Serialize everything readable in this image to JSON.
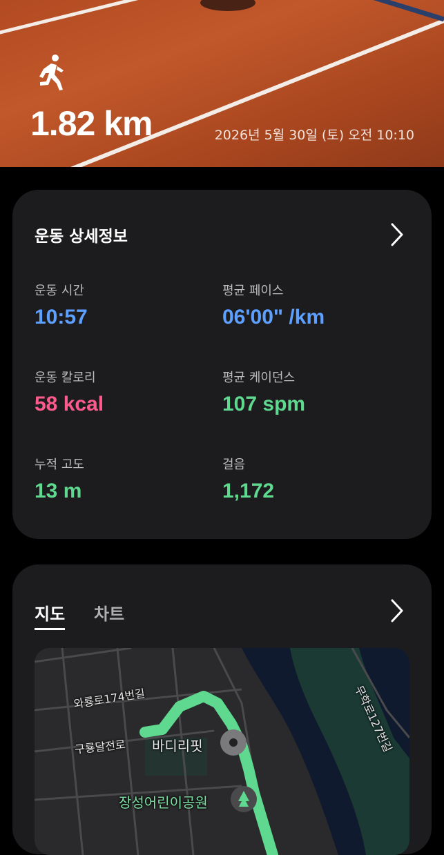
{
  "hero": {
    "distance": "1.82 km",
    "datetime": "2026년 5월 30일 (토) 오전 10:10",
    "activity_icon": "running-person-icon"
  },
  "details": {
    "title": "운동 상세정보",
    "stats": [
      {
        "label": "운동 시간",
        "value": "10:57",
        "color": "#5ea0ff"
      },
      {
        "label": "평균 페이스",
        "value": "06'00\" /km",
        "color": "#5ea0ff"
      },
      {
        "label": "운동 칼로리",
        "value": "58 kcal",
        "color": "#ff5a8e"
      },
      {
        "label": "평균 케이던스",
        "value": "107 spm",
        "color": "#5fd98f"
      },
      {
        "label": "누적 고도",
        "value": "13 m",
        "color": "#5fd98f"
      },
      {
        "label": "걸음",
        "value": "1,172",
        "color": "#5fd98f"
      }
    ]
  },
  "map_card": {
    "tabs": [
      {
        "label": "지도",
        "active": true
      },
      {
        "label": "차트",
        "active": false
      }
    ],
    "map_labels": {
      "road1": "와룡로174번길",
      "road2": "구룡달전로",
      "place1": "바디리핏",
      "park": "장성어린이공원",
      "road3": "무학로127번길"
    },
    "route_color": "#5fd98f"
  }
}
